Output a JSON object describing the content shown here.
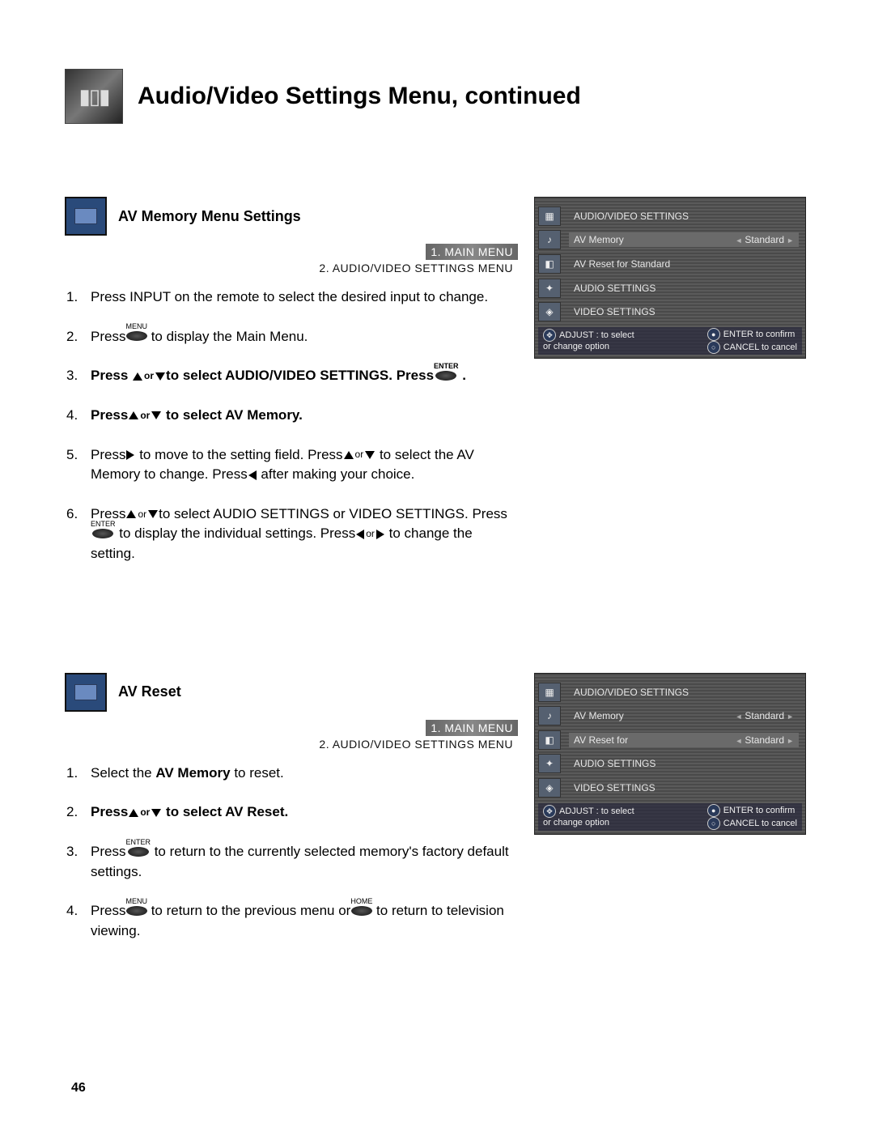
{
  "header": {
    "title": "Audio/Video Settings Menu, continued"
  },
  "page_number": "46",
  "sections": [
    {
      "id": "av_memory",
      "heading": "AV Memory Menu Settings",
      "breadcrumb": [
        "1. MAIN MENU",
        "2. AUDIO/VIDEO SETTINGS MENU"
      ],
      "steps": [
        {
          "type": "plain",
          "text": "Press INPUT on the remote to select the desired input to change."
        },
        {
          "type": "compound",
          "parts": [
            "Press",
            {
              "key": "MENU"
            },
            " to display the Main Menu."
          ]
        },
        {
          "type": "compound",
          "bold_whole": true,
          "parts": [
            "Press ",
            {
              "arrows": "updown"
            },
            "to select ",
            {
              "bold": "AUDIO/VIDEO SETTINGS"
            },
            ". Press",
            {
              "key": "ENTER"
            },
            " ."
          ]
        },
        {
          "type": "compound",
          "bold_whole": true,
          "parts": [
            "Press",
            {
              "arrows": "updown"
            },
            " to select ",
            {
              "bold": "AV Memory."
            }
          ]
        },
        {
          "type": "compound",
          "parts": [
            "Press",
            {
              "tri": "right"
            },
            " to move to the setting field.  Press",
            {
              "arrows": "updown"
            },
            " to select the AV Memory to change.  Press",
            {
              "tri": "left"
            },
            " after making your choice."
          ]
        },
        {
          "type": "compound",
          "parts": [
            "Press",
            {
              "arrows": "updown"
            },
            "to select AUDIO SETTINGS or VIDEO SETTINGS.  Press",
            {
              "key": "ENTER"
            },
            " to display the individual settings. Press",
            {
              "arrows": "leftright"
            },
            " to change the setting."
          ]
        }
      ],
      "osd": {
        "rows": [
          {
            "label": "AUDIO/VIDEO SETTINGS",
            "value": ""
          },
          {
            "label": "AV Memory",
            "value": "Standard",
            "highlight": true
          },
          {
            "label": "AV Reset for Standard",
            "value": ""
          },
          {
            "label": "AUDIO SETTINGS",
            "value": ""
          },
          {
            "label": "VIDEO SETTINGS",
            "value": ""
          }
        ],
        "sidebar_icons": [
          "▦",
          "♪",
          "◧",
          "✦",
          "◈"
        ],
        "footer": {
          "left_top": "ADJUST : to select",
          "left_bot": "or change option",
          "right_top": "ENTER to confirm",
          "right_bot": "CANCEL to cancel"
        }
      }
    },
    {
      "id": "av_reset",
      "heading": "AV Reset",
      "breadcrumb": [
        "1. MAIN MENU",
        "2. AUDIO/VIDEO SETTINGS MENU"
      ],
      "steps": [
        {
          "type": "compound",
          "parts": [
            "Select the ",
            {
              "bold": "AV Memory"
            },
            " to reset."
          ]
        },
        {
          "type": "compound",
          "bold_whole": true,
          "parts": [
            "Press",
            {
              "arrows": "updown"
            },
            " to select ",
            {
              "bold": "AV Reset."
            }
          ]
        },
        {
          "type": "compound",
          "parts": [
            "Press",
            {
              "key": "ENTER"
            },
            " to return to the currently selected memory's factory default settings."
          ]
        },
        {
          "type": "compound",
          "parts": [
            "Press",
            {
              "key": "MENU"
            },
            " to return to the previous menu or",
            {
              "key": "HOME"
            },
            " to return to television viewing."
          ]
        }
      ],
      "osd": {
        "rows": [
          {
            "label": "AUDIO/VIDEO SETTINGS",
            "value": ""
          },
          {
            "label": "AV Memory",
            "value": "Standard"
          },
          {
            "label": "AV Reset for",
            "value": "Standard",
            "highlight": true
          },
          {
            "label": "AUDIO SETTINGS",
            "value": ""
          },
          {
            "label": "VIDEO SETTINGS",
            "value": ""
          }
        ],
        "sidebar_icons": [
          "▦",
          "♪",
          "◧",
          "✦",
          "◈"
        ],
        "footer": {
          "left_top": "ADJUST : to select",
          "left_bot": "or change option",
          "right_top": "ENTER to confirm",
          "right_bot": "CANCEL to cancel"
        }
      }
    }
  ]
}
